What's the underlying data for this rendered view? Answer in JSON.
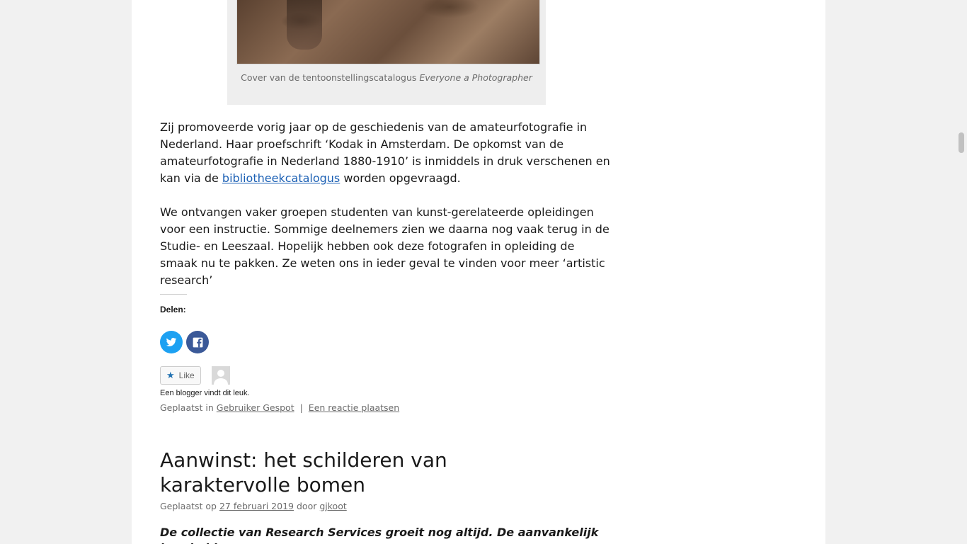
{
  "figure": {
    "caption_text": "Cover van de tentoonstellingscatalogus ",
    "caption_italic": "Everyone a Photographer"
  },
  "paragraph1": {
    "before_link": "Zij promoveerde vorig jaar op de geschiedenis van de amateurfotografie in Nederland. Haar proefschrift ‘Kodak in Amsterdam. De opkomst van de amateurfotografie in Nederland 1880-1910’ is inmiddels in druk verschenen en kan via de ",
    "link": "bibliotheekcatalogus",
    "after_link": " worden opgevraagd."
  },
  "paragraph2": "We ontvangen vaker groepen studenten van kunst-gerelateerde opleidingen voor een instructie. Sommige deelnemers zien we daarna nog vaak terug in de Studie- en Leeszaal. Hopelijk hebben ook deze fotografen in opleiding de smaak nu te pakken. Ze weten ons in ieder geval te vinden voor meer ‘artistic research’",
  "share": {
    "label": "Delen:",
    "icons": [
      "twitter-icon",
      "facebook-icon"
    ]
  },
  "like": {
    "button_label": "Like",
    "text": "Een blogger vindt dit leuk."
  },
  "post_meta": {
    "prefix": "Geplaatst in",
    "category": "Gebruiker Gespot",
    "separator": "|",
    "reply": "Een reactie plaatsen"
  },
  "next_post": {
    "title": "Aanwinst: het schilderen van karaktervolle bomen",
    "meta_prefix": "Geplaatst op",
    "date": "27 februari 2019",
    "by": "door",
    "author": "gjkoot",
    "excerpt": "De collectie van Research Services groeit nog altijd. De aanvankelijk bescheiden"
  },
  "colors": {
    "link": "#1a5fb4",
    "twitter": "#1da1f2",
    "facebook": "#3b5998"
  }
}
